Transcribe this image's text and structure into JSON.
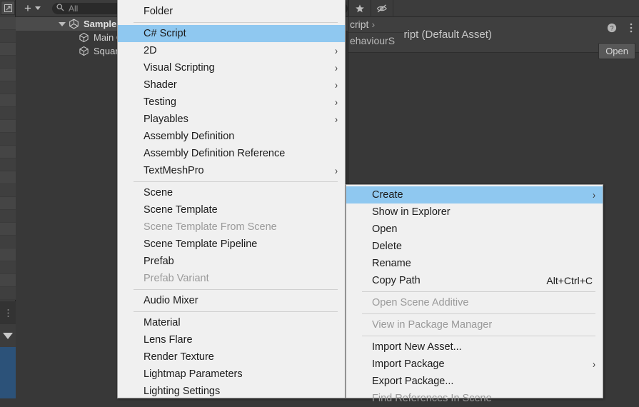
{
  "hierarchy": {
    "add_button_label": "+",
    "search_placeholder": "All",
    "search_icon": "magnifier-icon",
    "tree": [
      {
        "label": "SampleS",
        "icon": "scene-icon",
        "depth": 0,
        "expanded": true
      },
      {
        "label": "Main C",
        "icon": "gameobject-cube-icon",
        "depth": 1
      },
      {
        "label": "Square",
        "icon": "gameobject-cube-icon",
        "depth": 1
      }
    ]
  },
  "breadcrumb": {
    "line1": "cript",
    "line1_chevron": "›",
    "line2": "ehaviourS"
  },
  "inspector": {
    "star_icon": "star-icon",
    "hidden_icon": "eye-slash-icon",
    "asset_title": "Script (Default Asset)",
    "asset_icon": "folder-icon",
    "help_icon": "help-icon",
    "menu_icon": "kebab-menu-icon",
    "open_label": "Open"
  },
  "create_submenu": {
    "name": "Create",
    "items": [
      {
        "label": "Folder",
        "type": "item"
      },
      {
        "type": "separator"
      },
      {
        "label": "C# Script",
        "type": "item",
        "highlighted": true
      },
      {
        "label": "2D",
        "type": "item",
        "submenu": true
      },
      {
        "label": "Visual Scripting",
        "type": "item",
        "submenu": true
      },
      {
        "label": "Shader",
        "type": "item",
        "submenu": true
      },
      {
        "label": "Testing",
        "type": "item",
        "submenu": true
      },
      {
        "label": "Playables",
        "type": "item",
        "submenu": true
      },
      {
        "label": "Assembly Definition",
        "type": "item"
      },
      {
        "label": "Assembly Definition Reference",
        "type": "item"
      },
      {
        "label": "TextMeshPro",
        "type": "item",
        "submenu": true
      },
      {
        "type": "separator"
      },
      {
        "label": "Scene",
        "type": "item"
      },
      {
        "label": "Scene Template",
        "type": "item"
      },
      {
        "label": "Scene Template From Scene",
        "type": "item",
        "disabled": true
      },
      {
        "label": "Scene Template Pipeline",
        "type": "item"
      },
      {
        "label": "Prefab",
        "type": "item"
      },
      {
        "label": "Prefab Variant",
        "type": "item",
        "disabled": true
      },
      {
        "type": "separator"
      },
      {
        "label": "Audio Mixer",
        "type": "item"
      },
      {
        "type": "separator"
      },
      {
        "label": "Material",
        "type": "item"
      },
      {
        "label": "Lens Flare",
        "type": "item"
      },
      {
        "label": "Render Texture",
        "type": "item"
      },
      {
        "label": "Lightmap Parameters",
        "type": "item"
      },
      {
        "label": "Lighting Settings",
        "type": "item"
      }
    ]
  },
  "asset_context_menu": {
    "items": [
      {
        "label": "Create",
        "type": "item",
        "highlighted": true,
        "submenu": true
      },
      {
        "label": "Show in Explorer",
        "type": "item"
      },
      {
        "label": "Open",
        "type": "item"
      },
      {
        "label": "Delete",
        "type": "item"
      },
      {
        "label": "Rename",
        "type": "item"
      },
      {
        "label": "Copy Path",
        "type": "item",
        "shortcut": "Alt+Ctrl+C"
      },
      {
        "type": "separator"
      },
      {
        "label": "Open Scene Additive",
        "type": "item",
        "disabled": true
      },
      {
        "type": "separator"
      },
      {
        "label": "View in Package Manager",
        "type": "item",
        "disabled": true
      },
      {
        "type": "separator"
      },
      {
        "label": "Import New Asset...",
        "type": "item"
      },
      {
        "label": "Import Package",
        "type": "item",
        "submenu": true
      },
      {
        "label": "Export Package...",
        "type": "item"
      },
      {
        "label": "Find References In Scene",
        "type": "item",
        "disabled": true
      }
    ]
  },
  "colors": {
    "menu_background": "#f0f0f0",
    "menu_highlight": "#8fc8f0",
    "menu_text": "#1b1b1b",
    "menu_text_disabled": "#9a9a9a",
    "editor_background": "#383838",
    "panel_background": "#3c3c3c",
    "selection_blue": "#2c5279"
  }
}
